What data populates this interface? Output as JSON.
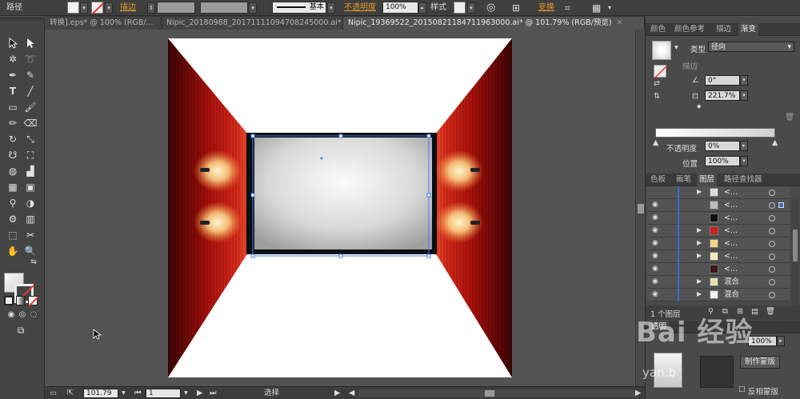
{
  "control_bar": {
    "object_type": "路径",
    "stroke_label": "描边",
    "brush_label": "基本",
    "opacity_label": "不透明度",
    "opacity_value": "100%",
    "style_label": "样式",
    "transform_label": "变换"
  },
  "tabs": [
    {
      "label": "转换].eps* @ 100% (RGB/..."
    },
    {
      "label": "Nipic_20180988_20171111094708245000.ai*"
    },
    {
      "label": "Nipic_19369522_20150821184711963000.ai* @ 101.79% (RGB/预览)"
    }
  ],
  "status": {
    "zoom": "101.79",
    "artboard": "1",
    "tool_name": "选择"
  },
  "color_panel": {
    "tabs": [
      "颜色",
      "颜色参考",
      "描边",
      "渐变"
    ]
  },
  "gradient_panel": {
    "type_label": "类型",
    "type_value": "径向",
    "stroke_label": "描边",
    "angle_value": "0°",
    "aspect_value": "221.7%",
    "opacity_label": "不透明度",
    "opacity_value": "0%",
    "location_label": "位置",
    "location_value": "100%"
  },
  "layers_panel": {
    "tabs": [
      "色板",
      "画笔",
      "图层",
      "路径查找器"
    ],
    "rows": [
      {
        "name": "<...",
        "has_arrow": true,
        "thumb": "#ddd"
      },
      {
        "name": "<...",
        "has_arrow": false,
        "thumb": "#bbb"
      },
      {
        "name": "<...",
        "has_arrow": false,
        "thumb": "#111"
      },
      {
        "name": "<...",
        "has_arrow": true,
        "thumb": "#c22"
      },
      {
        "name": "<...",
        "has_arrow": true,
        "thumb": "#f4d68c"
      },
      {
        "name": "<...",
        "has_arrow": true,
        "thumb": "#f4e8c0"
      },
      {
        "name": "<...",
        "has_arrow": false,
        "thumb": "#3a1a1a"
      },
      {
        "name": "混合",
        "has_arrow": true,
        "thumb": "#e8e2b0"
      },
      {
        "name": "混合",
        "has_arrow": true,
        "thumb": "#eee"
      }
    ],
    "layer_count": "1 个图层"
  },
  "transparency_panel": {
    "title": "透明",
    "opacity_value": "100%",
    "make_mask_button": "制作蒙版",
    "invert_mask_label": "反相蒙版"
  },
  "watermark": {
    "brand": "Bai 经验",
    "url": "yan.b"
  }
}
